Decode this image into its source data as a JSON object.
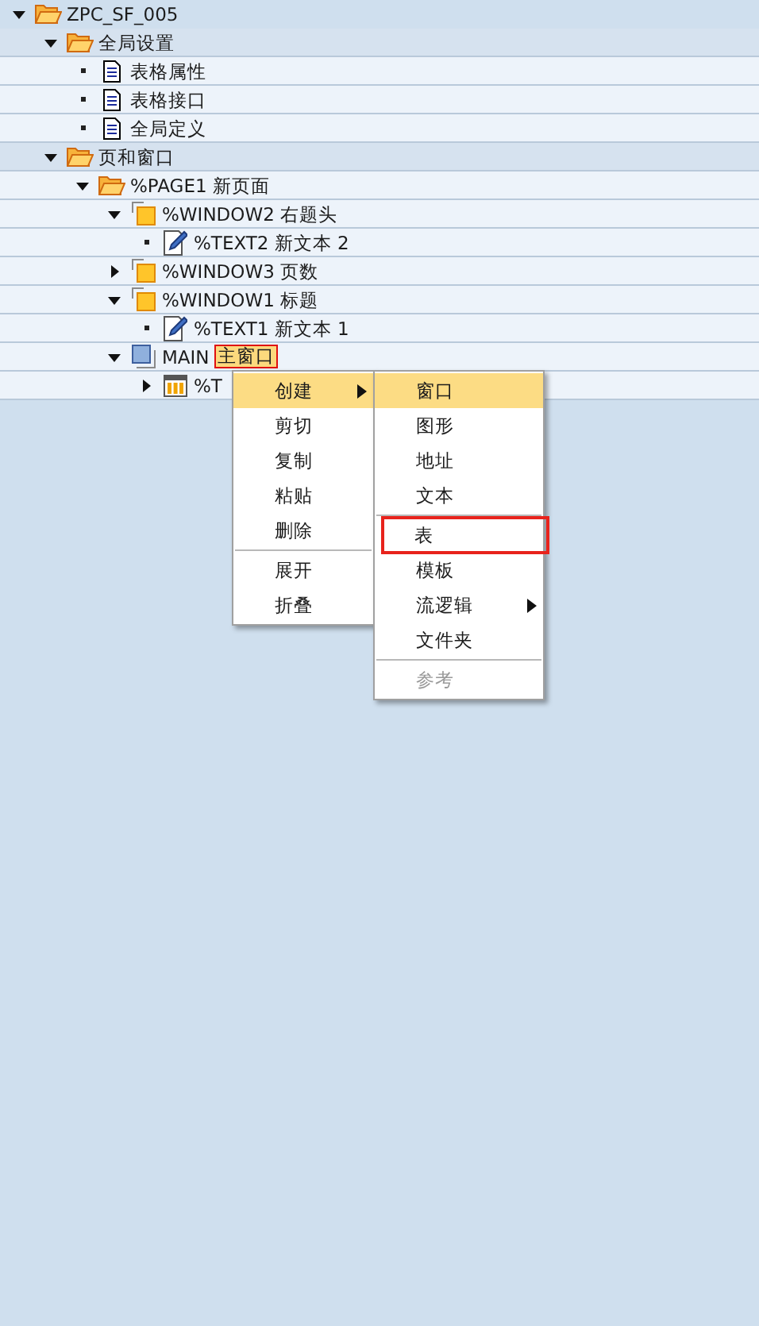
{
  "tree": [
    {
      "label": "ZPC_SF_005",
      "kind": "folder",
      "expanded": true,
      "selected": false,
      "children": [
        {
          "label": "全局设置",
          "kind": "folder",
          "expanded": true,
          "selected": false,
          "children": [
            {
              "label": "表格属性",
              "kind": "document",
              "selected": false
            },
            {
              "label": "表格接口",
              "kind": "document",
              "selected": false
            },
            {
              "label": "全局定义",
              "kind": "document",
              "selected": false
            }
          ]
        },
        {
          "label": "页和窗口",
          "kind": "folder",
          "expanded": true,
          "selected": false,
          "children": [
            {
              "label": "%PAGE1 新页面",
              "kind": "page",
              "expanded": true,
              "selected": false,
              "children": [
                {
                  "label": "%WINDOW2 右题头",
                  "kind": "window",
                  "expanded": true,
                  "selected": false,
                  "children": [
                    {
                      "label": "%TEXT2 新文本 2",
                      "kind": "text",
                      "selected": false
                    }
                  ]
                },
                {
                  "label": "%WINDOW3 页数",
                  "kind": "window",
                  "expanded": false,
                  "selected": false
                },
                {
                  "label": "%WINDOW1 标题",
                  "kind": "window",
                  "expanded": true,
                  "selected": false,
                  "children": [
                    {
                      "label": "%TEXT1 新文本 1",
                      "kind": "text",
                      "selected": false
                    }
                  ]
                },
                {
                  "label": "MAIN",
                  "description": "主窗口",
                  "kind": "main",
                  "expanded": true,
                  "selected": true,
                  "children": [
                    {
                      "label": "%T",
                      "kind": "table",
                      "expanded": false,
                      "selected": false
                    }
                  ]
                }
              ]
            }
          ]
        }
      ]
    }
  ],
  "context_menu": [
    {
      "kind": "item",
      "label": "创建",
      "selected": true,
      "submenu": true,
      "disabled": false,
      "marked": false
    },
    {
      "kind": "item",
      "label": "剪切",
      "selected": false,
      "submenu": false,
      "disabled": false,
      "marked": false
    },
    {
      "kind": "item",
      "label": "复制",
      "selected": false,
      "submenu": false,
      "disabled": false,
      "marked": false
    },
    {
      "kind": "item",
      "label": "粘贴",
      "selected": false,
      "submenu": false,
      "disabled": false,
      "marked": false
    },
    {
      "kind": "item",
      "label": "删除",
      "selected": false,
      "submenu": false,
      "disabled": false,
      "marked": false
    },
    {
      "kind": "separator"
    },
    {
      "kind": "item",
      "label": "展开",
      "selected": false,
      "submenu": false,
      "disabled": false,
      "marked": false
    },
    {
      "kind": "item",
      "label": "折叠",
      "selected": false,
      "submenu": false,
      "disabled": false,
      "marked": false
    }
  ],
  "submenu": [
    {
      "kind": "item",
      "label": "窗口",
      "selected": true,
      "submenu": false,
      "disabled": false,
      "marked": false
    },
    {
      "kind": "item",
      "label": "图形",
      "selected": false,
      "submenu": false,
      "disabled": false,
      "marked": false
    },
    {
      "kind": "item",
      "label": "地址",
      "selected": false,
      "submenu": false,
      "disabled": false,
      "marked": false
    },
    {
      "kind": "item",
      "label": "文本",
      "selected": false,
      "submenu": false,
      "disabled": false,
      "marked": false
    },
    {
      "kind": "separator"
    },
    {
      "kind": "item",
      "label": "表",
      "selected": false,
      "submenu": false,
      "disabled": false,
      "marked": true
    },
    {
      "kind": "item",
      "label": "模板",
      "selected": false,
      "submenu": false,
      "disabled": false,
      "marked": false
    },
    {
      "kind": "item",
      "label": "流逻辑",
      "selected": false,
      "submenu": true,
      "disabled": false,
      "marked": false
    },
    {
      "kind": "item",
      "label": "文件夹",
      "selected": false,
      "submenu": false,
      "disabled": false,
      "marked": false
    },
    {
      "kind": "separator"
    },
    {
      "kind": "item",
      "label": "参考",
      "selected": false,
      "submenu": false,
      "disabled": true,
      "marked": false
    }
  ]
}
